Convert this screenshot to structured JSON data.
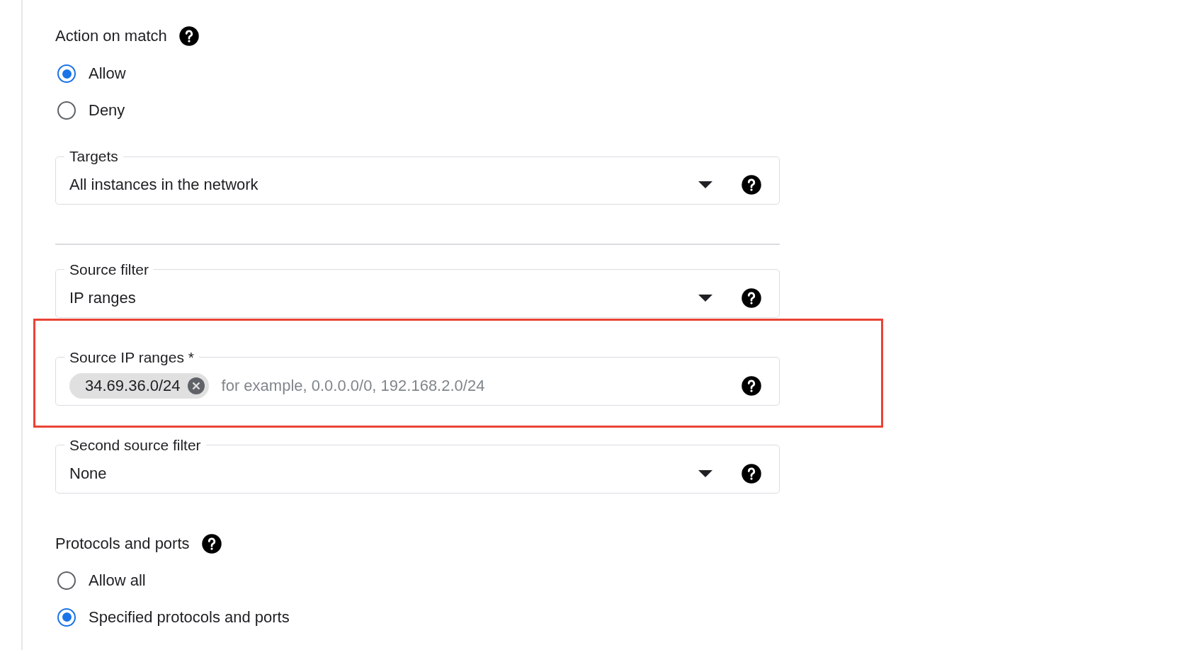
{
  "action_on_match": {
    "label": "Action on match",
    "options": [
      {
        "label": "Allow",
        "selected": true
      },
      {
        "label": "Deny",
        "selected": false
      }
    ]
  },
  "fields": [
    {
      "kind": "select",
      "label": "Targets",
      "value": "All instances in the network",
      "highlighted": false
    },
    {
      "kind": "divider"
    },
    {
      "kind": "select",
      "label": "Source filter",
      "value": "IP ranges",
      "highlighted": false
    },
    {
      "kind": "chips",
      "label": "Source IP ranges *",
      "chips": [
        "34.69.36.0/24"
      ],
      "placeholder": "for example, 0.0.0.0/0, 192.168.2.0/24",
      "highlighted": true
    },
    {
      "kind": "select",
      "label": "Second source filter",
      "value": "None",
      "highlighted": false
    }
  ],
  "protocols": {
    "label": "Protocols and ports",
    "options": [
      {
        "label": "Allow all",
        "selected": false
      },
      {
        "label": "Specified protocols and ports",
        "selected": true
      }
    ]
  }
}
